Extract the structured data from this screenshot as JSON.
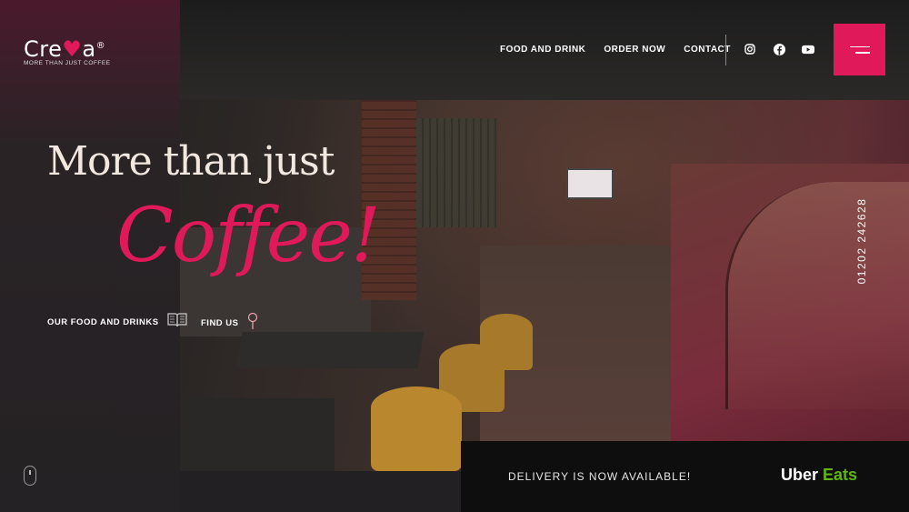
{
  "logo": {
    "brand_pre": "Cre",
    "brand_heart": "♥",
    "brand_post": "a",
    "registered": "®",
    "tagline": "MORE THAN JUST COFFEE"
  },
  "nav": {
    "items": [
      {
        "label": "FOOD AND DRINK"
      },
      {
        "label": "ORDER NOW"
      },
      {
        "label": "CONTACT"
      }
    ]
  },
  "social": {
    "icons": [
      "instagram-icon",
      "facebook-icon",
      "youtube-icon"
    ]
  },
  "menu_icon": "hamburger-menu-icon",
  "hero": {
    "headline": "More than just",
    "highlight": "Coffee!"
  },
  "cta": {
    "food": {
      "label": "OUR FOOD AND DRINKS",
      "icon": "book-icon"
    },
    "find": {
      "label": "FIND US",
      "icon": "map-pin-icon"
    }
  },
  "phone": "01202 242628",
  "delivery": {
    "text": "DELIVERY IS NOW AVAILABLE!",
    "partner_a": "Uber",
    "partner_b": "Eats"
  },
  "colors": {
    "accent": "#e0195a",
    "uber_green": "#5fb709"
  }
}
